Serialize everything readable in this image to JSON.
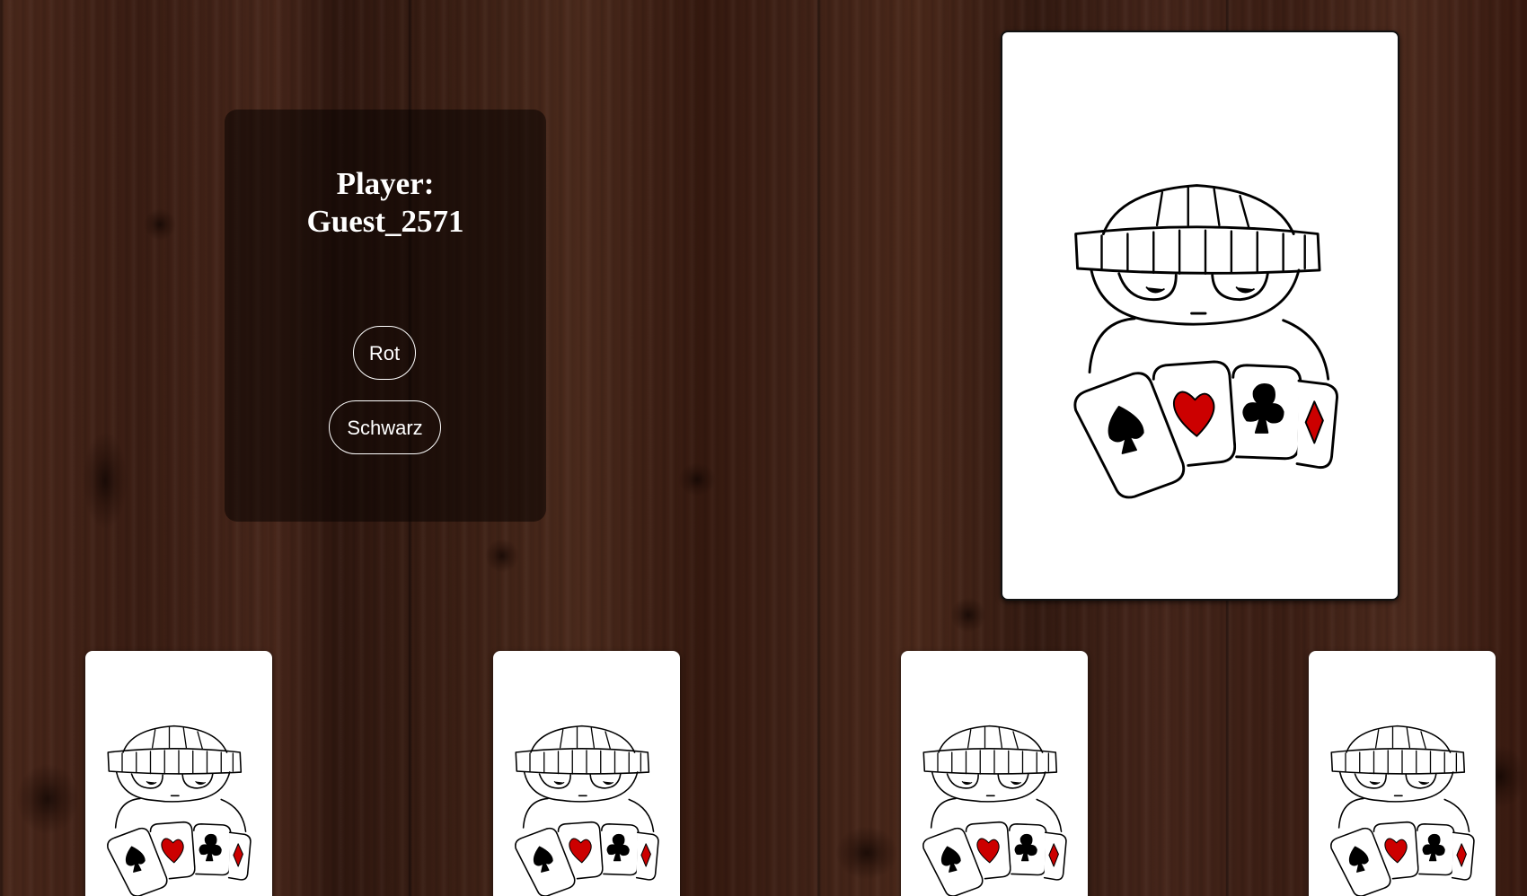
{
  "player_panel": {
    "title_line1": "Player:",
    "title_line2": "Guest_2571",
    "buttons": {
      "red_label": "Rot",
      "black_label": "Schwarz"
    }
  },
  "table": {
    "face_down_card": {
      "art": "card-back-beanie-character"
    },
    "hand": {
      "card_count": 4,
      "art": "card-back-beanie-character"
    }
  },
  "colors": {
    "suit_red": "#cc0000",
    "suit_black": "#000000",
    "panel_bg": "rgba(10,4,2,0.55)",
    "card_bg": "#ffffff"
  }
}
